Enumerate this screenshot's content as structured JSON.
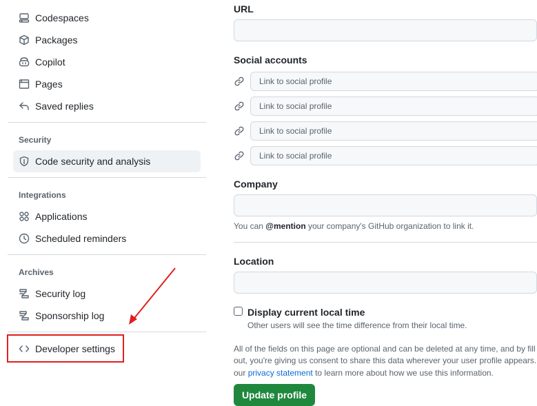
{
  "sidebar": {
    "items_top": [
      {
        "label": "Codespaces",
        "icon": "codespaces-icon"
      },
      {
        "label": "Packages",
        "icon": "package-icon"
      },
      {
        "label": "Copilot",
        "icon": "copilot-icon"
      },
      {
        "label": "Pages",
        "icon": "browser-icon"
      },
      {
        "label": "Saved replies",
        "icon": "reply-icon"
      }
    ],
    "security": {
      "title": "Security",
      "items": [
        {
          "label": "Code security and analysis",
          "icon": "shield-icon"
        }
      ]
    },
    "integrations": {
      "title": "Integrations",
      "items": [
        {
          "label": "Applications",
          "icon": "apps-icon"
        },
        {
          "label": "Scheduled reminders",
          "icon": "clock-icon"
        }
      ]
    },
    "archives": {
      "title": "Archives",
      "items": [
        {
          "label": "Security log",
          "icon": "log-icon"
        },
        {
          "label": "Sponsorship log",
          "icon": "log-icon"
        }
      ]
    },
    "developer_settings": {
      "label": "Developer settings",
      "icon": "code-icon"
    }
  },
  "profile": {
    "url_label": "URL",
    "url_value": "",
    "social_label": "Social accounts",
    "social_placeholder": "Link to social profile",
    "company_label": "Company",
    "company_value": "",
    "company_note_prefix": "You can",
    "company_note_mention": "@mention",
    "company_note_suffix": "your company's GitHub organization to link it.",
    "location_label": "Location",
    "location_value": "",
    "local_time_label": "Display current local time",
    "local_time_note": "Other users will see the time difference from their local time.",
    "local_time_checked": false,
    "optional_line1": "All of the fields on this page are optional and can be deleted at any time, and by fill",
    "optional_line2": "out, you're giving us consent to share this data wherever your user profile appears.",
    "optional_line3_prefix": "our",
    "privacy_link": "privacy statement",
    "optional_line3_suffix": "to learn more about how we use this information.",
    "update_button": "Update profile"
  },
  "colors": {
    "annotation": "#e01f1f",
    "primary_button": "#1f883d",
    "link": "#0969da"
  }
}
